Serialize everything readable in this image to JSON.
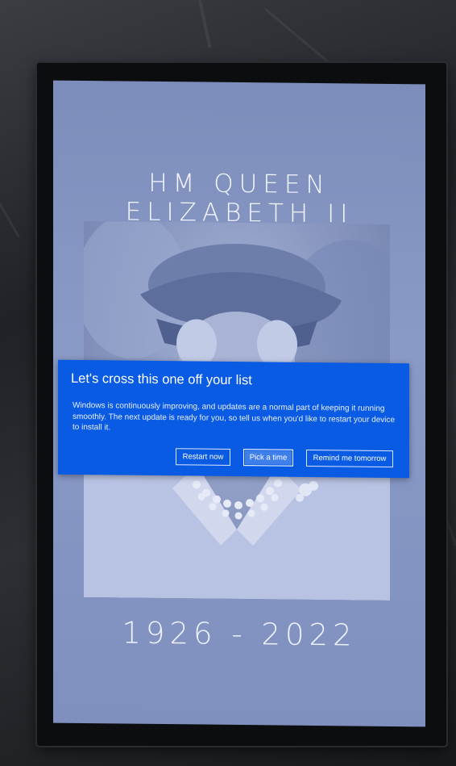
{
  "display": {
    "title": "HM QUEEN ELIZABETH II",
    "dates": "1926 - 2022"
  },
  "dialog": {
    "title": "Let's cross this one off your list",
    "body": "Windows is continuously improving, and updates are a normal part of keeping it running smoothly. The next update is ready for you, so tell us when you'd like to restart your device to install it.",
    "buttons": {
      "restart_now": "Restart now",
      "pick_a_time": "Pick a time",
      "remind_tomorrow": "Remind me tomorrow"
    },
    "accent_color": "#0a5be4"
  }
}
